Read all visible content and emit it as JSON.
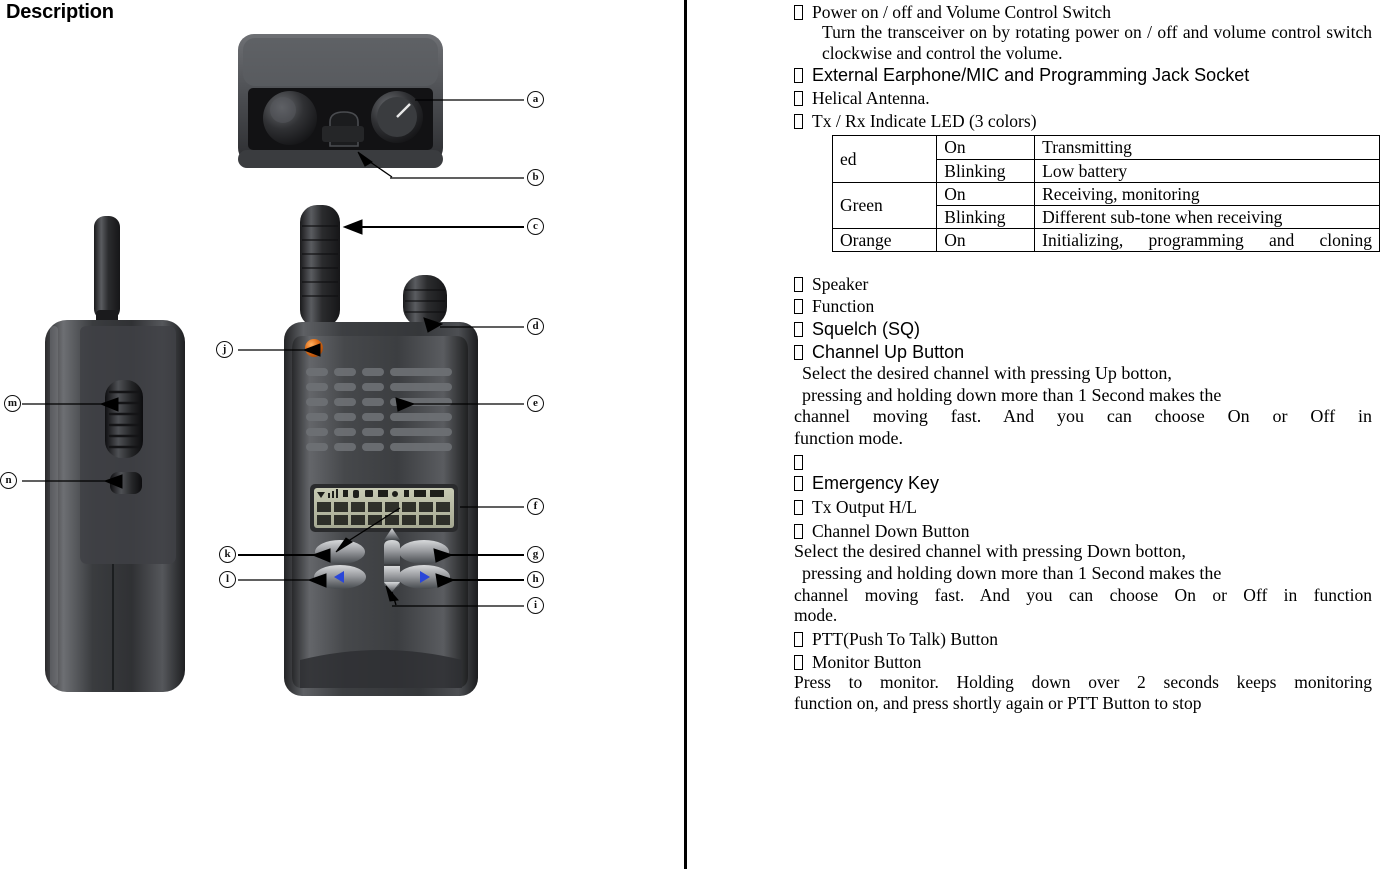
{
  "page": {
    "title": "Description"
  },
  "diagram": {
    "callouts": [
      {
        "id": "a",
        "label": "a"
      },
      {
        "id": "b",
        "label": "b"
      },
      {
        "id": "c",
        "label": "c"
      },
      {
        "id": "d",
        "label": "d"
      },
      {
        "id": "e",
        "label": "e"
      },
      {
        "id": "f",
        "label": "f"
      },
      {
        "id": "g",
        "label": "g"
      },
      {
        "id": "h",
        "label": "h"
      },
      {
        "id": "i",
        "label": "i"
      },
      {
        "id": "j",
        "label": "j"
      },
      {
        "id": "k",
        "label": "k"
      },
      {
        "id": "l",
        "label": "l"
      },
      {
        "id": "m",
        "label": "m"
      },
      {
        "id": "n",
        "label": "n"
      }
    ]
  },
  "content": {
    "item_a_title": "Power on / off and Volume Control Switch",
    "item_a_body": "Turn the transceiver on by rotating power on / off and volume control switch clockwise and control the volume.",
    "item_b_title": "External Earphone/MIC and Programming Jack Socket",
    "item_c_title": "Helical Antenna.",
    "item_d_title": "Tx / Rx Indicate LED (3 colors)",
    "item_e_title": "Speaker",
    "item_f_title": "Function",
    "item_g_title": "Squelch (SQ)",
    "item_h_title": "Channel Up Button",
    "item_h_body_1": "Select the desired channel with pressing Up botton,",
    "item_h_body_2": "pressing and holding down more than 1 Second makes the",
    "item_h_body_3": "channel moving fast. And you can choose On or Off in",
    "item_h_body_4": "function mode.",
    "item_blank_title": "",
    "item_i_title": "Emergency  Key",
    "item_j_title": "Tx  Output H/L",
    "item_k_title": "Channel Down Button",
    "item_k_body_1": "Select the desired channel with pressing Down botton,",
    "item_k_body_2": "pressing and holding down more than 1 Second makes the",
    "item_k_body_3": "channel moving fast. And you can choose On or Off in function",
    "item_k_body_4": "mode.",
    "item_l_title": "PTT(Push To Talk) Button",
    "item_m_title": "Monitor Button",
    "item_m_body_1": "Press to monitor. Holding down over 2 seconds keeps monitoring",
    "item_m_body_2": "function on, and press shortly again or PTT Button to stop"
  },
  "led_table": {
    "rows": [
      {
        "color": "ed",
        "state": "On",
        "desc": "Transmitting"
      },
      {
        "color": "",
        "state": "Blinking",
        "desc": "Low battery"
      },
      {
        "color": "Green",
        "state": "On",
        "desc": "Receiving, monitoring"
      },
      {
        "color": "",
        "state": "Blinking",
        "desc": "Different sub-tone when receiving"
      },
      {
        "color": "Orange",
        "state": "On",
        "desc": "Initializing, programming and cloning"
      }
    ]
  }
}
